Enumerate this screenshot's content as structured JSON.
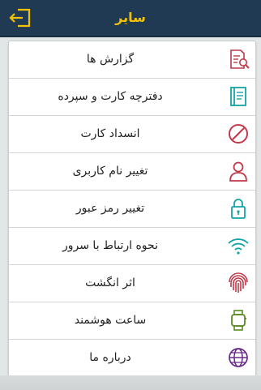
{
  "header": {
    "title": "سایر",
    "back_icon": "logout-arrow-icon"
  },
  "colors": {
    "header_bg": "#1f3a52",
    "header_title": "#f2c200",
    "back_icon": "#f2c200"
  },
  "menu": {
    "items": [
      {
        "label": "گزارش ها",
        "icon": "report-search-icon",
        "color": "#c0394b"
      },
      {
        "label": "دفترچه کارت و سپرده",
        "icon": "notebook-icon",
        "color": "#12a5a5"
      },
      {
        "label": "انسداد کارت",
        "icon": "block-icon",
        "color": "#c0394b"
      },
      {
        "label": "تغییر نام کاربری",
        "icon": "user-icon",
        "color": "#c0394b"
      },
      {
        "label": "تغییر رمز عبور",
        "icon": "lock-icon",
        "color": "#12a5a5"
      },
      {
        "label": "نحوه ارتباط با سرور",
        "icon": "wifi-icon",
        "color": "#12a5a5"
      },
      {
        "label": "اثر انگشت",
        "icon": "fingerprint-icon",
        "color": "#c0394b"
      },
      {
        "label": "ساعت هوشمند",
        "icon": "smartwatch-icon",
        "color": "#5a8a20"
      },
      {
        "label": "درباره ما",
        "icon": "globe-icon",
        "color": "#6a2a8a"
      }
    ]
  }
}
